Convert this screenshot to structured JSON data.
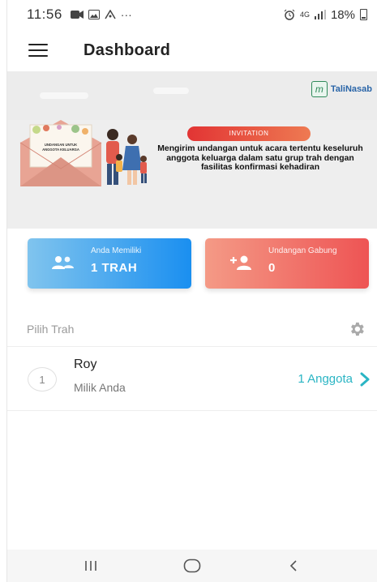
{
  "status_bar": {
    "time": "11:56",
    "more": "···",
    "network": "4G",
    "battery": "18%"
  },
  "app_bar": {
    "title": "Dashboard"
  },
  "banner": {
    "logo_text": "TaliNasab",
    "envelope_text": "UNDANGAN UNTUK ANGGOTA KELUARGA",
    "pill_label": "INVITATION",
    "description": "Mengirim undangan untuk acara  tertentu keseluruh anggota keluarga dalam satu grup trah dengan fasilitas konfirmasi kehadiran"
  },
  "cards": {
    "trah": {
      "label": "Anda Memiliki",
      "value": "1 TRAH"
    },
    "invites": {
      "label": "Undangan Gabung",
      "value": "0"
    }
  },
  "section": {
    "label": "Pilih Trah"
  },
  "trah_list": [
    {
      "index": "1",
      "name": "Roy",
      "owner": "Milik Anda",
      "members": "1 Anggota"
    }
  ],
  "icons": {
    "menu": "menu-icon",
    "gear": "gear-icon",
    "chevron": "chevron-right-icon",
    "group": "group-icon",
    "add_person": "add-person-icon"
  },
  "colors": {
    "card_blue": "#1a8ff0",
    "card_red": "#ee5454",
    "accent_teal": "#2ab5c4",
    "invite_pill": "#e23434"
  }
}
